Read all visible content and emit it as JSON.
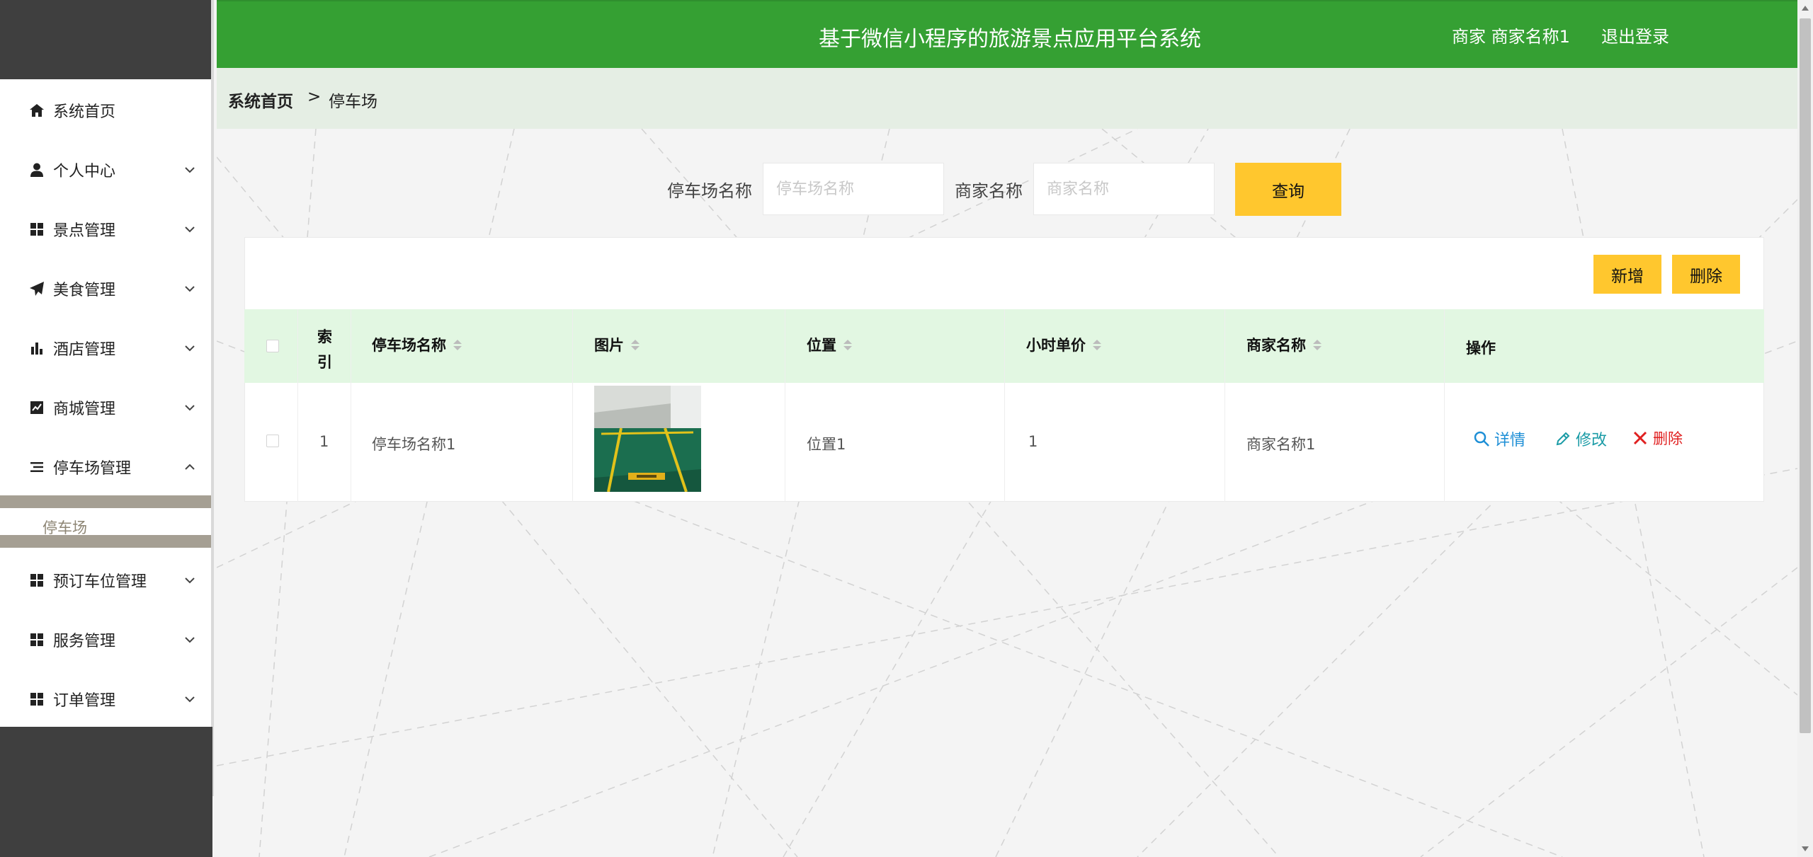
{
  "header": {
    "title": "基于微信小程序的旅游景点应用平台系统",
    "user": "商家 商家名称1",
    "logout": "退出登录"
  },
  "sidebar": {
    "items": [
      {
        "label": "系统首页",
        "icon": "home-icon"
      },
      {
        "label": "个人中心",
        "icon": "user-icon"
      },
      {
        "label": "景点管理",
        "icon": "grid-icon"
      },
      {
        "label": "美食管理",
        "icon": "paper-plane-icon"
      },
      {
        "label": "酒店管理",
        "icon": "bar-chart-icon"
      },
      {
        "label": "商城管理",
        "icon": "line-chart-icon"
      },
      {
        "label": "停车场管理",
        "icon": "list-icon"
      },
      {
        "label": "预订车位管理",
        "icon": "grid-icon"
      },
      {
        "label": "服务管理",
        "icon": "grid-icon"
      },
      {
        "label": "订单管理",
        "icon": "grid-icon"
      }
    ],
    "sub_item": "停车场"
  },
  "breadcrumb": {
    "home": "系统首页",
    "separator": ">",
    "current": "停车场"
  },
  "search": {
    "name_label": "停车场名称",
    "name_placeholder": "停车场名称",
    "merchant_label": "商家名称",
    "merchant_placeholder": "商家名称",
    "query_button": "查询"
  },
  "toolbar": {
    "add_button": "新增",
    "delete_button": "删除"
  },
  "table": {
    "headers": {
      "index": "索引",
      "name": "停车场名称",
      "image": "图片",
      "location": "位置",
      "hourly_price": "小时单价",
      "merchant": "商家名称",
      "actions": "操作"
    },
    "rows": [
      {
        "index": "1",
        "name": "停车场名称1",
        "location": "位置1",
        "hourly_price": "1",
        "merchant": "商家名称1"
      }
    ],
    "actions": {
      "detail": "详情",
      "edit": "修改",
      "delete": "删除"
    }
  },
  "colors": {
    "header_green": "#35a033",
    "accent_yellow": "#ffc72e",
    "sidebar_dark": "#3f3f3f",
    "table_header": "#e2f7e2",
    "link_blue": "#1e8fd6",
    "delete_red": "#e02020"
  }
}
